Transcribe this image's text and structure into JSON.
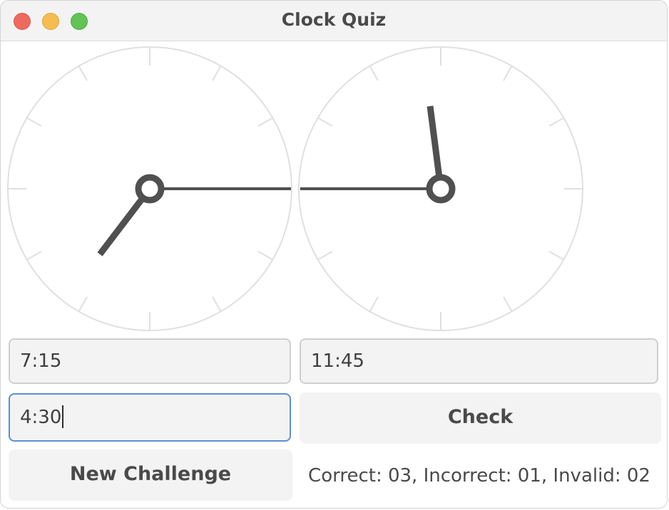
{
  "window": {
    "title": "Clock Quiz",
    "controls": [
      "close",
      "minimize",
      "zoom"
    ]
  },
  "clocks": [
    {
      "name": "clock-left",
      "hour_hand_minutes": 7.0
    },
    {
      "name": "clock-right",
      "hour_hand_minutes": 11.75
    }
  ],
  "fields": {
    "answer_one": "7:15",
    "answer_two": "11:45",
    "input_value": "4:30"
  },
  "buttons": {
    "check_label": "Check",
    "new_challenge_label": "New Challenge"
  },
  "status": {
    "text": "Correct: 03, Incorrect: 01, Invalid: 02"
  },
  "colors": {
    "hand": "#505050",
    "face_stroke": "#e0e0e0",
    "focus": "#5b8fd6"
  }
}
